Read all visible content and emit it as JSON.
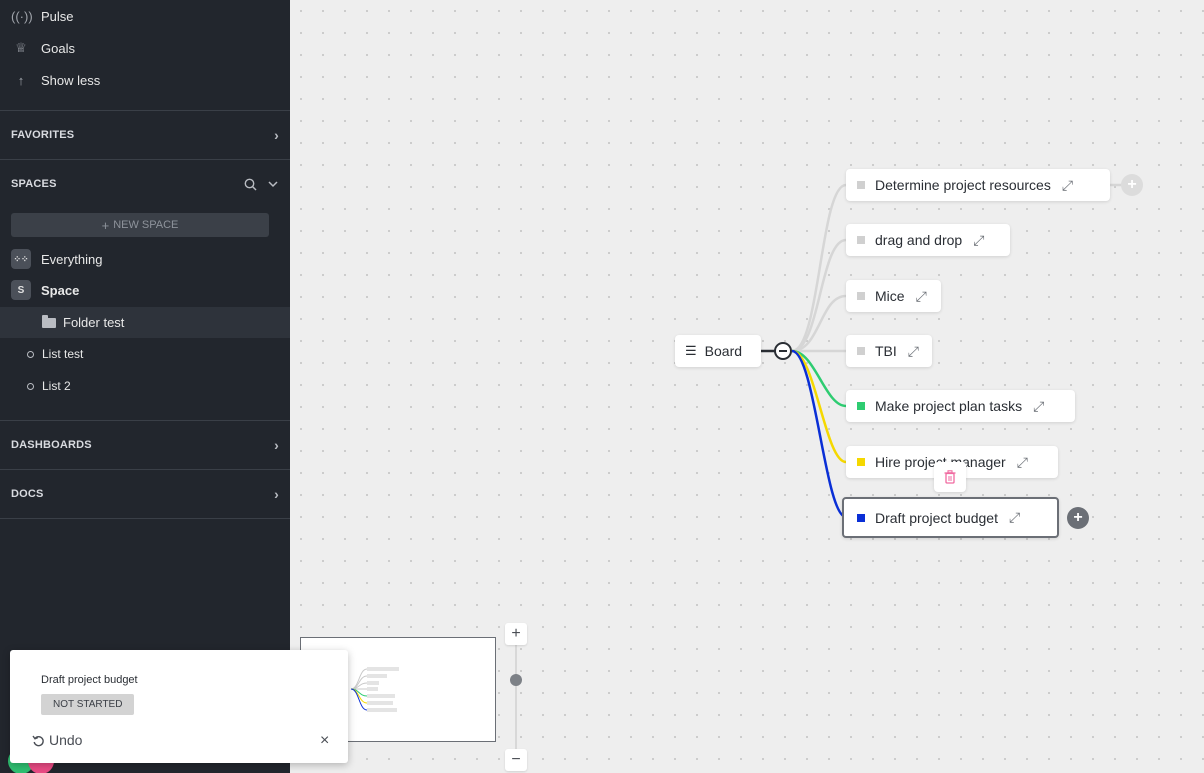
{
  "sidebar": {
    "top_items": [
      {
        "label": "Pulse",
        "icon": "pulse-icon"
      },
      {
        "label": "Goals",
        "icon": "trophy-icon"
      },
      {
        "label": "Show less",
        "icon": "arrow-up-icon"
      }
    ],
    "favorites": "FAVORITES",
    "spaces": "SPACES",
    "new_space": "NEW SPACE",
    "everything": "Everything",
    "space_badge": "S",
    "space": "Space",
    "folder": "Folder test",
    "lists": [
      "List test",
      "List 2"
    ],
    "dashboards": "DASHBOARDS",
    "docs": "DOCS"
  },
  "mindmap": {
    "root": "Board",
    "nodes": [
      {
        "label": "Determine project resources",
        "color": "#d0d0d0"
      },
      {
        "label": "drag and drop",
        "color": "#d0d0d0"
      },
      {
        "label": "Mice",
        "color": "#d0d0d0"
      },
      {
        "label": "TBI",
        "color": "#d0d0d0"
      },
      {
        "label": "Make project plan tasks",
        "color": "#2ecc71"
      },
      {
        "label": "Hire project manager",
        "color": "#f5d800"
      },
      {
        "label": "Draft project budget",
        "color": "#0a2fd6"
      }
    ]
  },
  "toast": {
    "title": "Draft project budget",
    "status": "NOT STARTED",
    "undo": "Undo",
    "close": "×"
  },
  "zoom": {
    "in": "+",
    "out": "−"
  }
}
